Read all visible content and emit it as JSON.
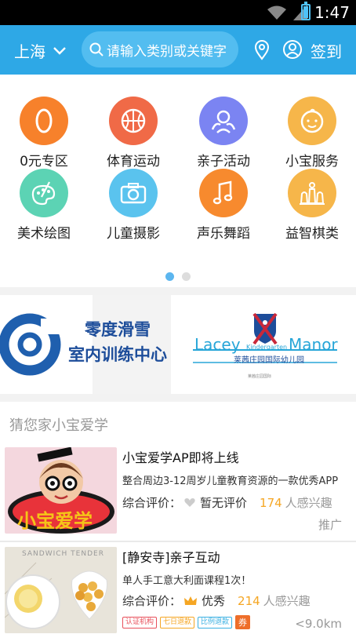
{
  "status": {
    "time": "1:47"
  },
  "header": {
    "city": "上海",
    "search_placeholder": "请输入类别或关键字",
    "signin": "签到"
  },
  "categories": [
    {
      "label": "0元专区",
      "color": "#f7812b",
      "icon": "zero-icon"
    },
    {
      "label": "体育运动",
      "color": "#f06a47",
      "icon": "basketball-icon"
    },
    {
      "label": "亲子活动",
      "color": "#7b84f2",
      "icon": "family-icon"
    },
    {
      "label": "小宝服务",
      "color": "#f6b64a",
      "icon": "baby-face-icon"
    },
    {
      "label": "美术绘图",
      "color": "#5cd3b4",
      "icon": "palette-icon"
    },
    {
      "label": "儿童摄影",
      "color": "#5ac3ee",
      "icon": "camera-icon"
    },
    {
      "label": "声乐舞蹈",
      "color": "#f78a2e",
      "icon": "music-note-icon"
    },
    {
      "label": "益智棋类",
      "color": "#f6b64a",
      "icon": "chess-icon"
    }
  ],
  "banner": {
    "left_text_line1": "零度滑雪",
    "left_text_line2": "室内训练中心",
    "right_brand_left": "Lacey",
    "right_brand_mid": "Kindergarten",
    "right_brand_right": "Manor",
    "right_sub": "莱茜庄园国际幼儿园",
    "right_small": "莱茜庄园国际"
  },
  "recommend": {
    "title": "猜您家小宝爱学",
    "items": [
      {
        "title": "小宝爱学AP即将上线",
        "desc": "整合周边3-12周岁儿童教育资源的一款优秀APP",
        "rating_label": "综合评价：",
        "grade": "暂无评价",
        "interest_num": "174",
        "interest_text": "人感兴趣",
        "tag": "推广",
        "thumb_text": "小宝爱学"
      },
      {
        "title": "[静安寺]亲子互动",
        "desc": "单人手工意大利面课程1次！",
        "rating_label": "综合评价：",
        "grade": "优秀",
        "interest_num": "214",
        "interest_text": "人感兴趣",
        "badges": [
          "认证机构",
          "七日退款",
          "比例退款"
        ],
        "coupon": "券",
        "distance": "<9.0km",
        "thumb_text": "SANDWICH TENDER"
      }
    ]
  }
}
